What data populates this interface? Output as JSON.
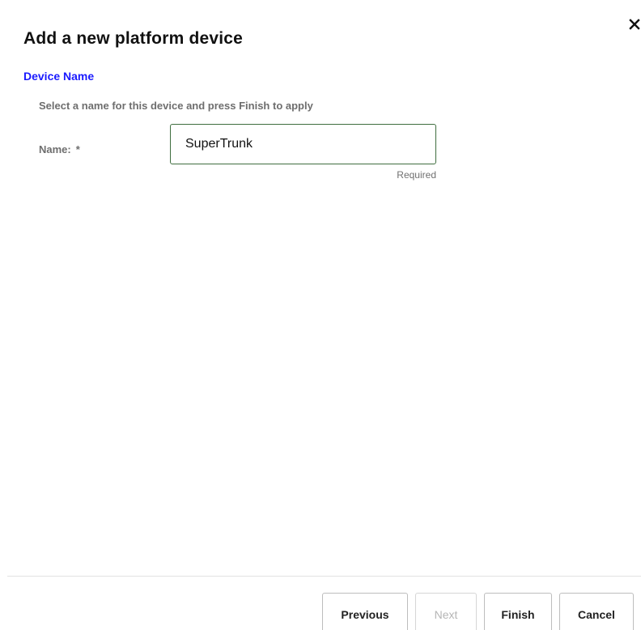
{
  "dialog": {
    "title": "Add a new platform device",
    "close_icon": "close-icon"
  },
  "section": {
    "link_label": "Device Name"
  },
  "form": {
    "instructions": "Select a name for this device and press Finish to apply",
    "name_label": "Name:",
    "required_marker": "*",
    "name_value": "SuperTrunk",
    "required_hint": "Required"
  },
  "footer": {
    "previous_label": "Previous",
    "next_label": "Next",
    "finish_label": "Finish",
    "cancel_label": "Cancel"
  },
  "colors": {
    "link": "#1a1aff",
    "input_border": "#3f6e3f",
    "muted_text": "#6e6e6e"
  }
}
